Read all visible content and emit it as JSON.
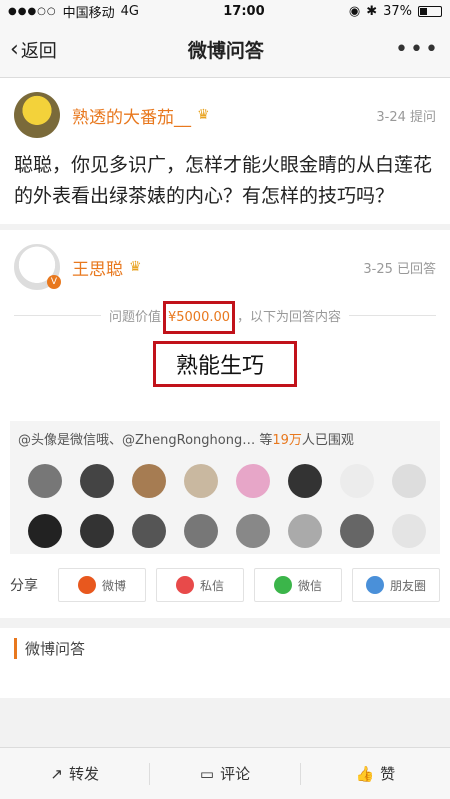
{
  "status": {
    "carrier": "中国移动",
    "network": "4G",
    "time": "17:00",
    "battery": "37%"
  },
  "nav": {
    "back_label": "返回",
    "title": "微博问答",
    "more_label": "•••"
  },
  "question": {
    "asker": "熟透的大番茄__",
    "meta": "3-24 提问",
    "text": "聪聪，你见多识广，怎样才能火眼金睛的从白莲花的外表看出绿茶婊的内心？有怎样的技巧吗？"
  },
  "answer": {
    "answerer": "王思聪",
    "meta": "3-25 已回答",
    "price_prefix": "问题价值",
    "price_amount": "¥5000.00",
    "price_suffix": "，以下为回答内容",
    "text": "熟能生巧"
  },
  "viewers": {
    "prefix": "@头像是微信哦、@ZhengRonghong… 等",
    "count": "19万",
    "suffix": "人已围观",
    "avatar_colors": [
      "#777",
      "#444",
      "#a67c52",
      "#c9b8a0",
      "#e7a6c8",
      "#333",
      "#ececec",
      "#ddd",
      "#222",
      "#333",
      "#555",
      "#777",
      "#888",
      "#aaa",
      "#666",
      "#e4e4e4"
    ]
  },
  "share": {
    "label": "分享",
    "buttons": [
      {
        "label": "微博",
        "icon_color": "#e8581e"
      },
      {
        "label": "私信",
        "icon_color": "#e84a4a"
      },
      {
        "label": "微信",
        "icon_color": "#3bb54a"
      },
      {
        "label": "朋友圈",
        "icon_color": "#4a90d9"
      }
    ]
  },
  "section": {
    "title": "微博问答"
  },
  "bottom": {
    "repost": "转发",
    "comment": "评论",
    "like": "赞"
  }
}
